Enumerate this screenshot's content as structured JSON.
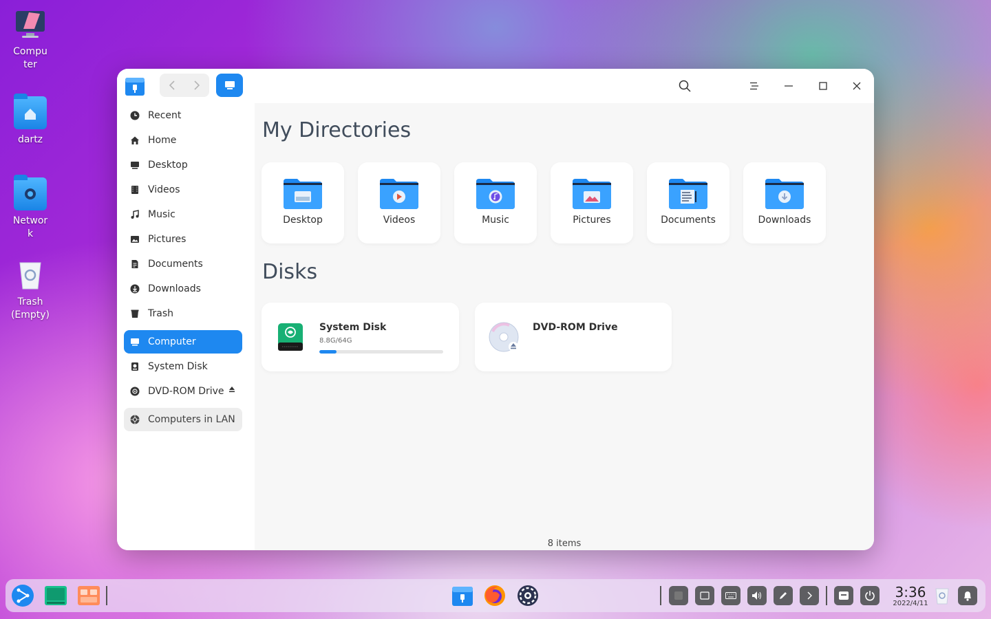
{
  "desktop": {
    "icons": [
      {
        "label": "Computer",
        "icon": "computer-icon"
      },
      {
        "label": "dartz",
        "icon": "home-folder-icon"
      },
      {
        "label": "Network",
        "icon": "network-folder-icon"
      },
      {
        "label": "Trash\n(Empty)",
        "icon": "trash-icon"
      }
    ]
  },
  "window": {
    "sidebar": {
      "items": [
        {
          "label": "Recent",
          "icon": "clock-icon"
        },
        {
          "label": "Home",
          "icon": "home-icon"
        },
        {
          "label": "Desktop",
          "icon": "desktop-icon"
        },
        {
          "label": "Videos",
          "icon": "film-icon"
        },
        {
          "label": "Music",
          "icon": "music-note-icon"
        },
        {
          "label": "Pictures",
          "icon": "image-icon"
        },
        {
          "label": "Documents",
          "icon": "document-icon"
        },
        {
          "label": "Downloads",
          "icon": "download-icon"
        },
        {
          "label": "Trash",
          "icon": "trash-icon"
        },
        {
          "label": "Computer",
          "icon": "computer-icon",
          "active": true
        },
        {
          "label": "System Disk",
          "icon": "disk-icon"
        },
        {
          "label": "DVD-ROM Drive",
          "icon": "disc-icon"
        },
        {
          "label": "Computers in LAN",
          "icon": "network-icon"
        }
      ]
    },
    "content": {
      "dirs_title": "My Directories",
      "directories": [
        {
          "label": "Desktop",
          "icon": "desktop-folder-icon"
        },
        {
          "label": "Videos",
          "icon": "videos-folder-icon"
        },
        {
          "label": "Music",
          "icon": "music-folder-icon"
        },
        {
          "label": "Pictures",
          "icon": "pictures-folder-icon"
        },
        {
          "label": "Documents",
          "icon": "documents-folder-icon"
        },
        {
          "label": "Downloads",
          "icon": "downloads-folder-icon"
        }
      ],
      "disks_title": "Disks",
      "disks": [
        {
          "name": "System Disk",
          "size": "8.8G/64G",
          "used_fraction": 0.1375,
          "icon": "system-disk-icon"
        },
        {
          "name": "DVD-ROM Drive",
          "icon": "dvd-icon"
        }
      ],
      "status": "8 items"
    }
  },
  "clock": {
    "time": "3:36",
    "date": "2022/4/11"
  },
  "colors": {
    "accent": "#1e88f0"
  }
}
